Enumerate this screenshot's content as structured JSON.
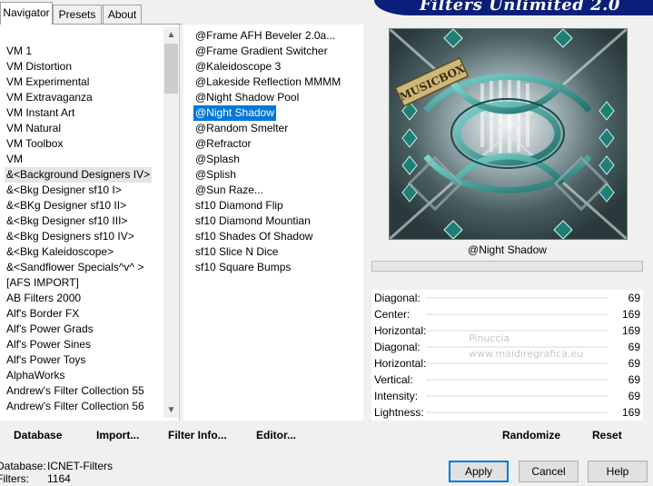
{
  "tabs": [
    "Navigator",
    "Presets",
    "About"
  ],
  "banner_title": "Filters Unlimited 2.0",
  "categories": [
    "VM 1",
    "VM Distortion",
    "VM Experimental",
    "VM Extravaganza",
    "VM Instant Art",
    "VM Natural",
    "VM Toolbox",
    "VM",
    "&<Background Designers IV>",
    "&<Bkg Designer sf10 I>",
    "&<BKg Designer sf10 II>",
    "&<Bkg Designer sf10 III>",
    "&<Bkg Designers sf10 IV>",
    "&<Bkg Kaleidoscope>",
    "&<Sandflower Specials^v^ >",
    "[AFS IMPORT]",
    "AB Filters 2000",
    "Alf's Border FX",
    "Alf's Power Grads",
    "Alf's Power Sines",
    "Alf's Power Toys",
    "AlphaWorks",
    "Andrew's Filter Collection 55",
    "Andrew's Filter Collection 56"
  ],
  "filters": [
    "@Frame AFH Beveler 2.0a...",
    "@Frame Gradient Switcher",
    "@Kaleidoscope 3",
    "@Lakeside Reflection MMMM",
    "@Night Shadow Pool",
    "@Night Shadow",
    "@Random Smelter",
    "@Refractor",
    "@Splash",
    "@Splish",
    "@Sun Raze...",
    "sf10 Diamond Flip",
    "sf10 Diamond Mountian",
    "sf10 Shades Of Shadow",
    "sf10 Slice N Dice",
    "sf10 Square Bumps"
  ],
  "selected_filter": "@Night Shadow",
  "preview_label": "MUSICBOX",
  "parameters": [
    {
      "label": "Diagonal:",
      "value": "69"
    },
    {
      "label": "Center:",
      "value": "169"
    },
    {
      "label": "Horizontal:",
      "value": "169"
    },
    {
      "label": "Diagonal:",
      "value": "69"
    },
    {
      "label": "Horizontal:",
      "value": "69"
    },
    {
      "label": "Vertical:",
      "value": "69"
    },
    {
      "label": "Intensity:",
      "value": "69"
    },
    {
      "label": "Lightness:",
      "value": "169"
    }
  ],
  "watermark": {
    "line1": "Pinuccia",
    "line2": "www.maidiregrafica.eu"
  },
  "toolbar": {
    "database": "Database",
    "import": "Import...",
    "filter_info": "Filter Info...",
    "editor": "Editor...",
    "randomize": "Randomize",
    "reset": "Reset"
  },
  "status": {
    "database_label": "Database:",
    "database_value": "ICNET-Filters",
    "filters_label": "Filters:",
    "filters_value": "1164"
  },
  "buttons": {
    "apply": "Apply",
    "cancel": "Cancel",
    "help": "Help"
  },
  "colors": {
    "accent": "#0078d7",
    "banner": "#0a1f7a"
  }
}
